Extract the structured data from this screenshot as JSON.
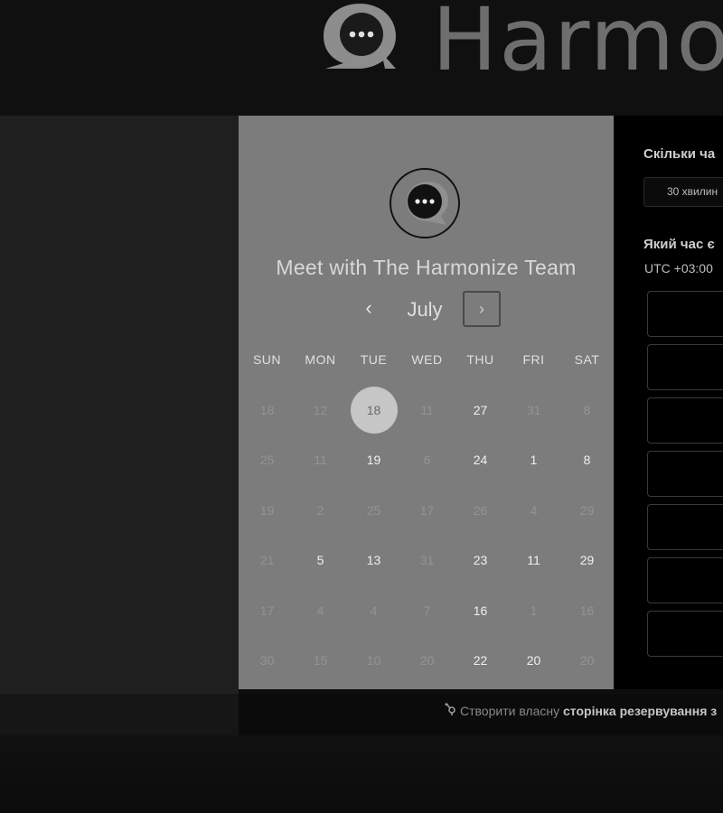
{
  "brand": {
    "name": "Harmo",
    "logo_icon": "chat-bubble-logo"
  },
  "calendar": {
    "title": "Meet with The Harmonize Team",
    "month": "July",
    "prev_label": "‹",
    "next_label": "›",
    "weekdays": [
      "SUN",
      "MON",
      "TUE",
      "WED",
      "THU",
      "FRI",
      "SAT"
    ],
    "weeks": [
      [
        [
          "18",
          "off"
        ],
        [
          "12",
          "off"
        ],
        [
          "18",
          "sel"
        ],
        [
          "11",
          "off"
        ],
        [
          "27",
          "on"
        ],
        [
          "31",
          "off"
        ],
        [
          "8",
          "off"
        ]
      ],
      [
        [
          "25",
          "off"
        ],
        [
          "11",
          "off"
        ],
        [
          "19",
          "on"
        ],
        [
          "6",
          "off"
        ],
        [
          "24",
          "on"
        ],
        [
          "1",
          "on"
        ],
        [
          "8",
          "on"
        ]
      ],
      [
        [
          "19",
          "off"
        ],
        [
          "2",
          "off"
        ],
        [
          "25",
          "off"
        ],
        [
          "17",
          "off"
        ],
        [
          "26",
          "off"
        ],
        [
          "4",
          "off"
        ],
        [
          "29",
          "off"
        ]
      ],
      [
        [
          "21",
          "off"
        ],
        [
          "5",
          "on"
        ],
        [
          "13",
          "on"
        ],
        [
          "31",
          "off"
        ],
        [
          "23",
          "on"
        ],
        [
          "11",
          "on"
        ],
        [
          "29",
          "on"
        ]
      ],
      [
        [
          "17",
          "off"
        ],
        [
          "4",
          "off"
        ],
        [
          "4",
          "off"
        ],
        [
          "7",
          "off"
        ],
        [
          "16",
          "on"
        ],
        [
          "1",
          "off"
        ],
        [
          "16",
          "off"
        ]
      ],
      [
        [
          "30",
          "off"
        ],
        [
          "15",
          "off"
        ],
        [
          "10",
          "off"
        ],
        [
          "20",
          "off"
        ],
        [
          "22",
          "on"
        ],
        [
          "20",
          "on"
        ],
        [
          "20",
          "off"
        ]
      ]
    ]
  },
  "booking": {
    "duration_question": "Скільки ча",
    "duration_value": "30 хвилин",
    "time_question": "Який час є",
    "timezone": "UTC +03:00",
    "slot_count": 7
  },
  "footer": {
    "prefix": "Створити власну",
    "strong": "сторінка резервування з",
    "icon": "sprocket-icon"
  }
}
